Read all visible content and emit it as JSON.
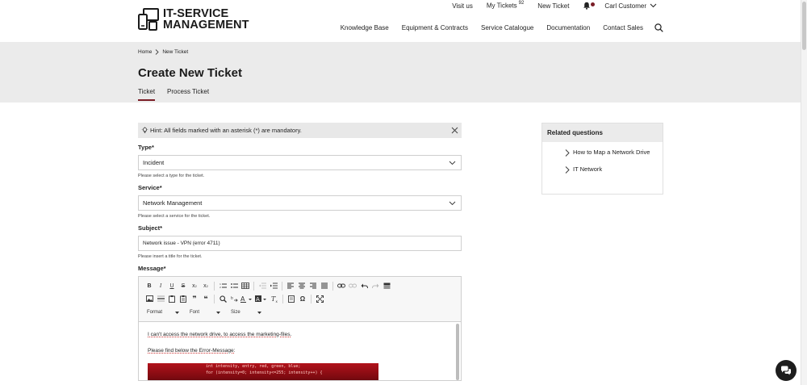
{
  "brand": {
    "line1": "IT-SERVICE",
    "line2": "MANAGEMENT"
  },
  "topbar": {
    "visit": "Visit us",
    "tickets": "My Tickets",
    "tickets_count": "92",
    "new_ticket": "New Ticket",
    "user": "Carl Customer"
  },
  "nav": [
    "Knowledge Base",
    "Equipment & Contracts",
    "Service Catalogue",
    "Documentation",
    "Contact Sales"
  ],
  "breadcrumb": {
    "home": "Home",
    "current": "New Ticket"
  },
  "page": {
    "title": "Create New Ticket"
  },
  "tabs": [
    {
      "label": "Ticket"
    },
    {
      "label": "Process Ticket"
    }
  ],
  "hint": "Hint: All fields marked with an asterisk (*) are mandatory.",
  "form": {
    "type": {
      "label": "Type*",
      "value": "Incident",
      "help": "Please select a type for the ticket."
    },
    "service": {
      "label": "Service*",
      "value": "Network Management",
      "help": "Please select a service for the ticket."
    },
    "subject": {
      "label": "Subject*",
      "value": "Network issue - VPN (error 4711)",
      "help": "Please insert a title for the ticket."
    },
    "message": {
      "label": "Message*",
      "line1": "I can't access the network drive, to access the marketing-files.",
      "line2": "Please find below the Error-Message:",
      "code1": "int intensity, entry, red, green, blue;",
      "code2": "for (intensity=0; intensity<=255; intensity++) {"
    }
  },
  "editor_toolbar": {
    "format": "Format",
    "font": "Font",
    "size": "Size"
  },
  "related": {
    "title": "Related questions",
    "items": [
      "How to Map a Network Drive",
      "IT Network"
    ]
  }
}
